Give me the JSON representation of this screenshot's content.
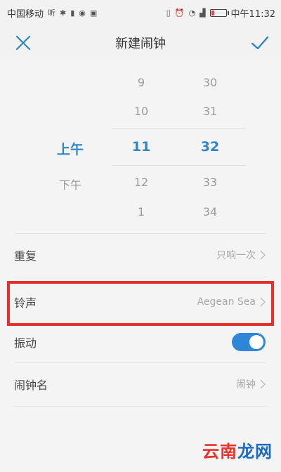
{
  "status_bar": {
    "carrier": "中国移动",
    "right_text": "中午11:32"
  },
  "header": {
    "title": "新建闹钟"
  },
  "picker": {
    "ampm": {
      "above": "",
      "selected": "上午",
      "below": "下午"
    },
    "hour": {
      "values": [
        "9",
        "10",
        "11",
        "12",
        "1"
      ],
      "selected": "11"
    },
    "minute": {
      "values": [
        "30",
        "31",
        "32",
        "33",
        "34"
      ],
      "selected": "32"
    }
  },
  "rows": {
    "repeat": {
      "label": "重复",
      "value": "只响一次"
    },
    "ringtone": {
      "label": "铃声",
      "value": "Aegean Sea"
    },
    "vibrate": {
      "label": "振动",
      "on": true
    },
    "alarm_name": {
      "label": "闹钟名",
      "value": "闹钟"
    }
  },
  "watermark": {
    "part1": "云南",
    "part2": "龙网"
  },
  "colors": {
    "accent": "#2e86c9",
    "toggle": "#2e86d9",
    "highlight": "#e53030"
  }
}
